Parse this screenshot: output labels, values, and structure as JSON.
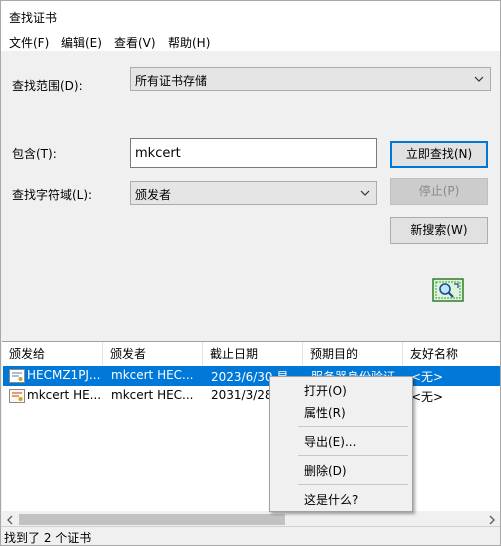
{
  "window": {
    "title": "查找证书"
  },
  "menu": [
    "文件(F)",
    "编辑(E)",
    "查看(V)",
    "帮助(H)"
  ],
  "form": {
    "scope_label": "查找范围(D):",
    "scope_value": "所有证书存储",
    "contains_label": "包含(T):",
    "contains_value": "mkcert",
    "field_label": "查找字符域(L):",
    "field_value": "颁发者"
  },
  "buttons": {
    "find_now": "立即查找(N)",
    "stop": "停止(P)",
    "new_search": "新搜索(W)"
  },
  "table": {
    "columns": [
      "颁发给",
      "颁发者",
      "截止日期",
      "预期目的",
      "友好名称"
    ],
    "rows": [
      {
        "issued_to": "HECMZ1PJ...",
        "issuer": "mkcert HEC...",
        "expires": "2023/6/30 星",
        "purpose": "服务器身份验证",
        "friendly": "<无>",
        "selected": true
      },
      {
        "issued_to": "mkcert HE...",
        "issuer": "mkcert HEC...",
        "expires": "2031/3/28",
        "purpose": "",
        "friendly": "<无>",
        "selected": false
      }
    ]
  },
  "context_menu": {
    "open": "打开(O)",
    "properties": "属性(R)",
    "export": "导出(E)...",
    "delete": "删除(D)",
    "whats_this": "这是什么?"
  },
  "status": {
    "text": "找到了 2 个证书"
  },
  "colors": {
    "accent": "#0078d7",
    "window_bg": "#f0f0f0"
  }
}
